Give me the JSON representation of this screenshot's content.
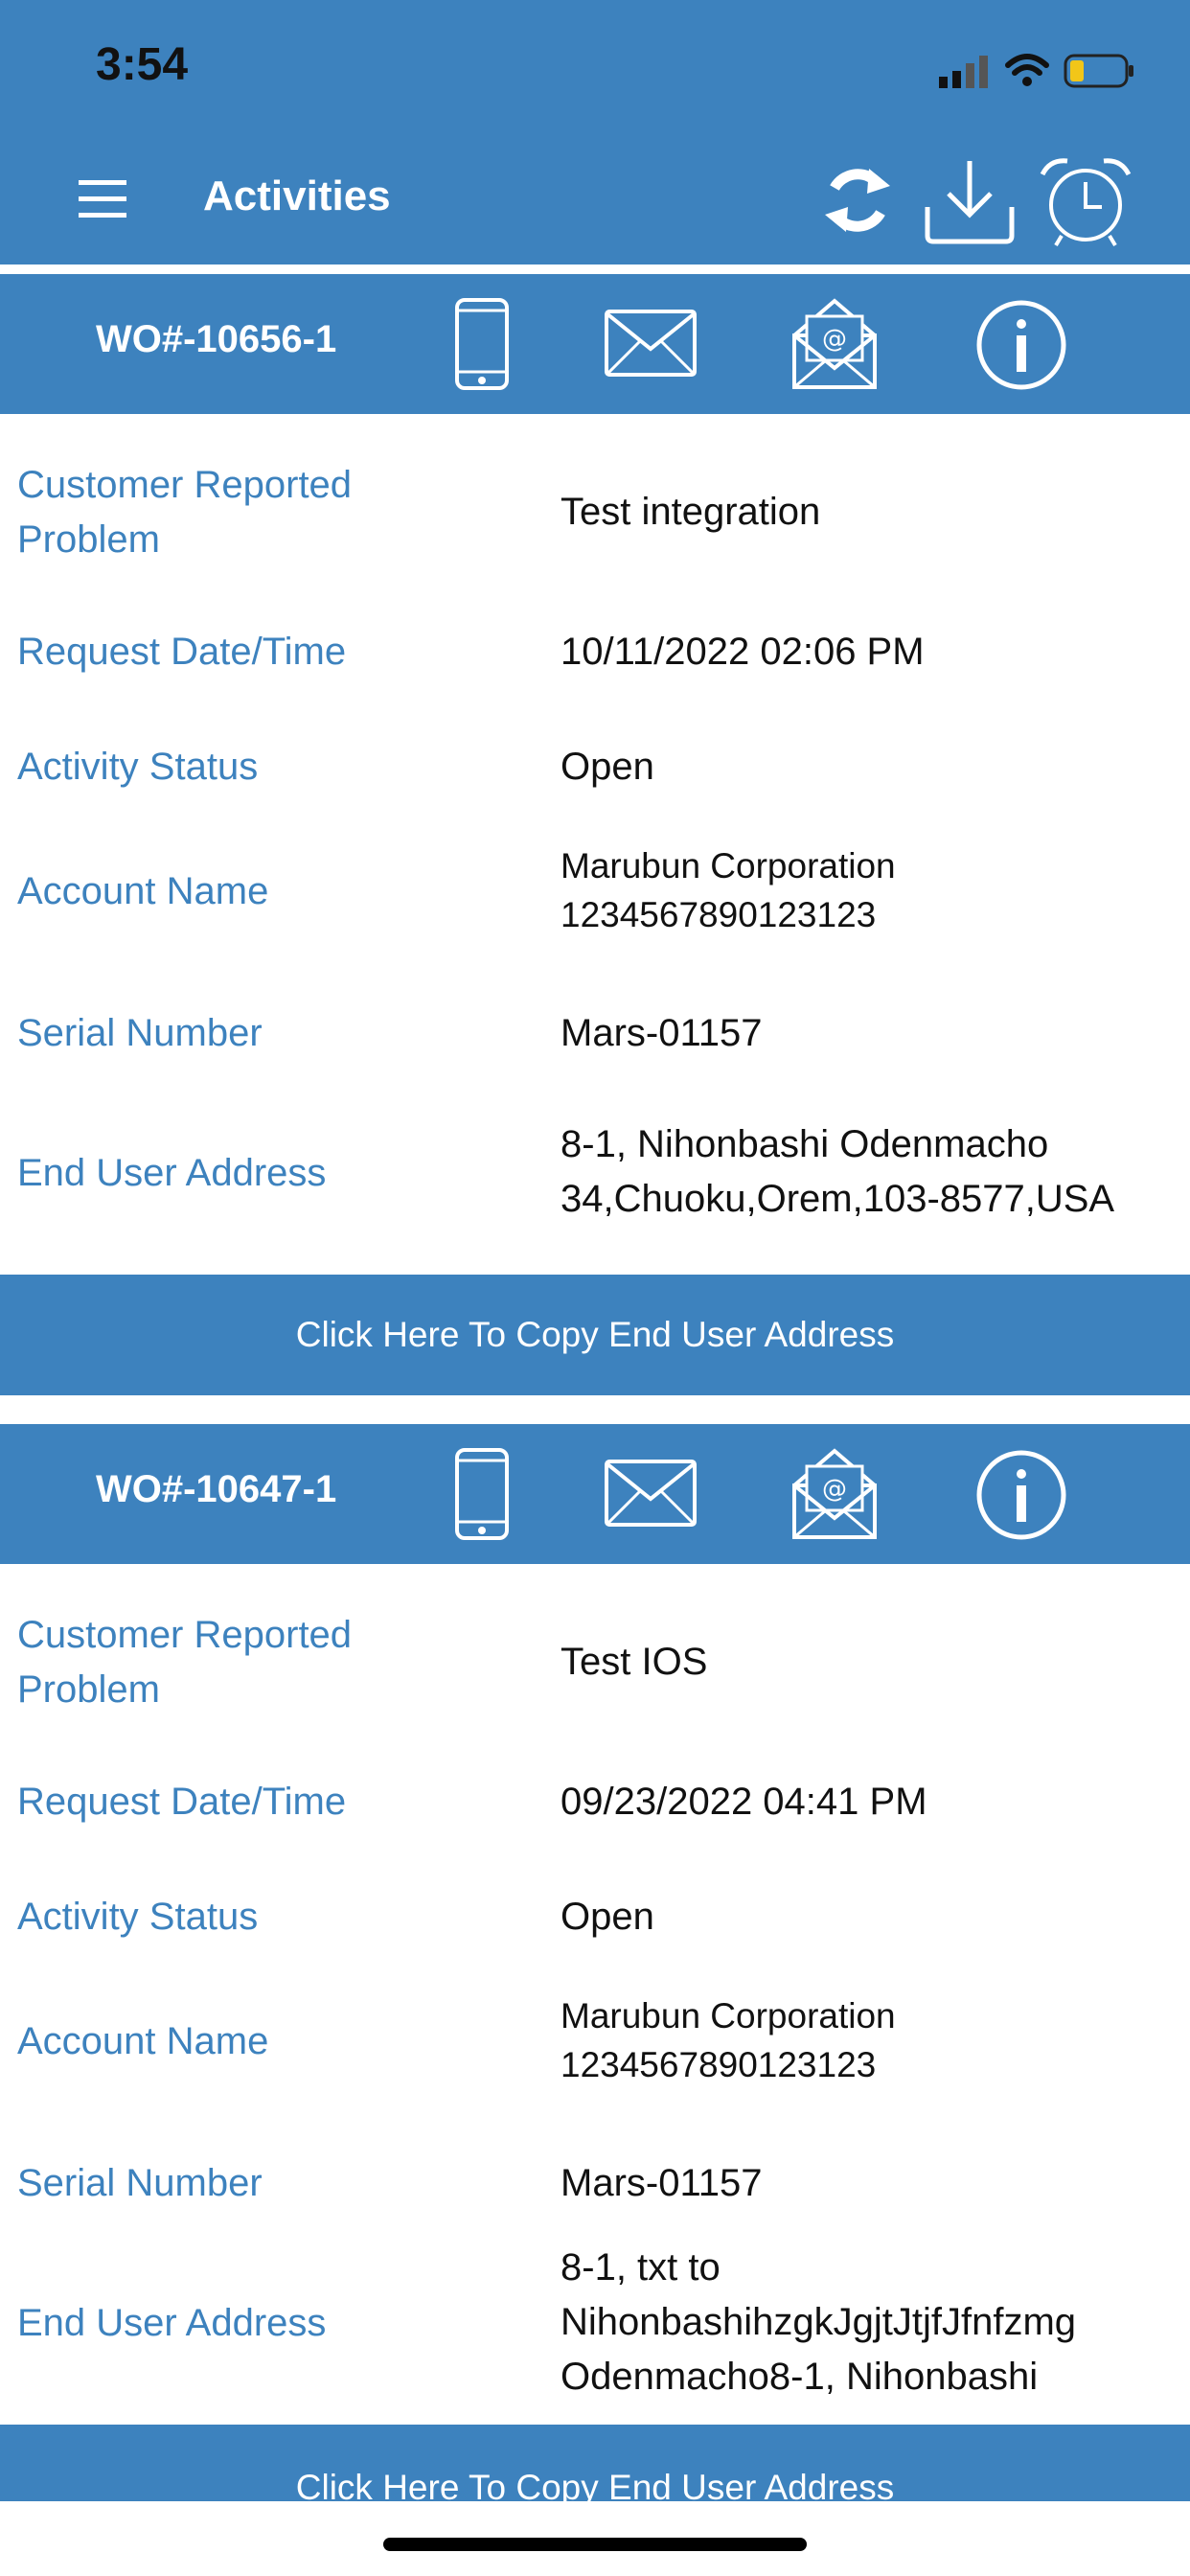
{
  "status": {
    "time": "3:54"
  },
  "nav": {
    "title": "Activities"
  },
  "icons": [
    "menu-icon",
    "sync-icon",
    "download-icon",
    "alarm-clock-icon",
    "phone-icon",
    "mail-icon",
    "email-at-icon",
    "info-icon"
  ],
  "activities": [
    {
      "wo": "WO#-10656-1",
      "labels": [
        "Customer Reported Problem",
        "Request Date/Time",
        "Activity Status",
        "Account Name",
        "Serial Number",
        "End User Address"
      ],
      "problem": "Test integration",
      "request_date": "10/11/2022 02:06 PM",
      "status": "Open",
      "account_line1": "Marubun Corporation",
      "account_line2": "1234567890123123",
      "serial": "Mars-01157",
      "address_line1": "8-1, Nihonbashi Odenmacho",
      "address_line2": "34,Chuoku,Orem,103-8577,USA",
      "copy_label": "Click Here To Copy End User Address"
    },
    {
      "wo": "WO#-10647-1",
      "labels": [
        "Customer Reported Problem",
        "Request Date/Time",
        "Activity Status",
        "Account Name",
        "Serial Number",
        "End User Address"
      ],
      "problem": "Test IOS",
      "request_date": "09/23/2022 04:41 PM",
      "status": "Open",
      "account_line1": "Marubun Corporation",
      "account_line2": "1234567890123123",
      "serial": "Mars-01157",
      "address_line1": "8-1, txt to",
      "address_line2": "NihonbashihzgkJgjtJtjfJfnfzmg",
      "address_line3": "Odenmacho8-1, Nihonbashi",
      "copy_label": "Click Here To Copy End User Address"
    }
  ],
  "colors": {
    "primary": "#3d82be",
    "text": "#111111",
    "background": "#ffffff"
  }
}
